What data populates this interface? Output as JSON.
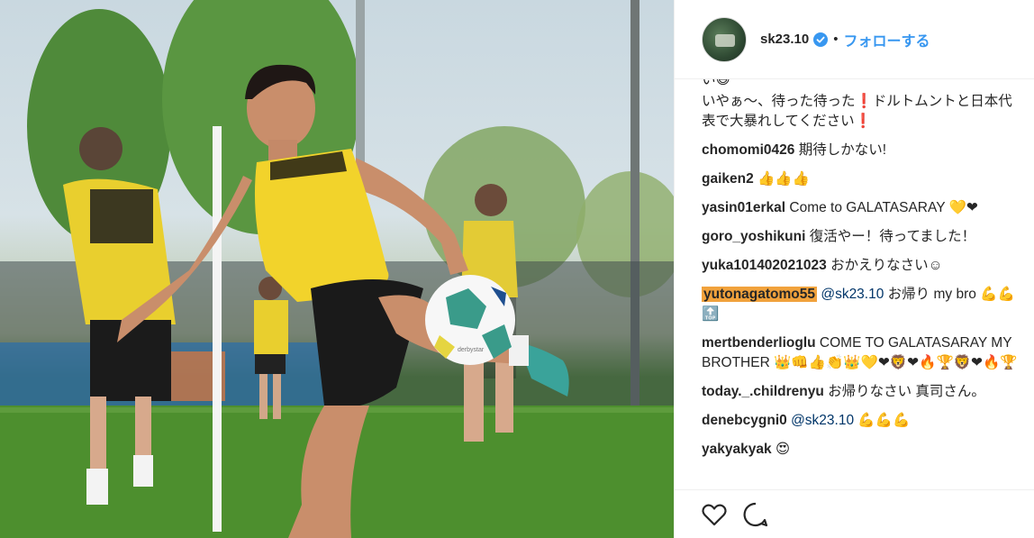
{
  "post": {
    "username": "sk23.10",
    "follow_label": "フォローする",
    "separator": "•",
    "ball_brand": "derbystar"
  },
  "comments": [
    {
      "user": "",
      "text": "い😆"
    },
    {
      "user": "",
      "text": "いやぁ〜、待った待った❗️ドルトムントと日本代表で大暴れしてください❗️"
    },
    {
      "user": "chomomi0426",
      "text": "期待しかない!"
    },
    {
      "user": "gaiken2",
      "text": "👍👍👍"
    },
    {
      "user": "yasin01erkal",
      "text": "Come to GALATASARAY 💛❤"
    },
    {
      "user": "goro_yoshikuni",
      "text": "復活やー！待ってました！"
    },
    {
      "user": "yuka101402021023",
      "text": "おかえりなさい☺"
    },
    {
      "user": "yutonagatomo55",
      "mention": "@sk23.10",
      "text": "お帰り my bro 💪💪🔝",
      "highlight": true
    },
    {
      "user": "mertbenderlioglu",
      "text": "COME TO GALATASARAY MY BROTHER 👑👊👍👏👑💛❤🦁❤🔥🏆🦁❤🔥🏆"
    },
    {
      "user": "today._.childrenyu",
      "text": "お帰りなさい 真司さん。"
    },
    {
      "user": "denebcygni0",
      "mention": "@sk23.10",
      "text": "💪💪💪"
    },
    {
      "user": "yakyakyak",
      "text": "😍"
    }
  ],
  "actions": {
    "like_icon": "heart-icon",
    "comment_icon": "comment-bubble-icon"
  },
  "colors": {
    "accent": "#3897f0",
    "highlight": "#f1a23c",
    "jersey": "#f2d32b"
  }
}
